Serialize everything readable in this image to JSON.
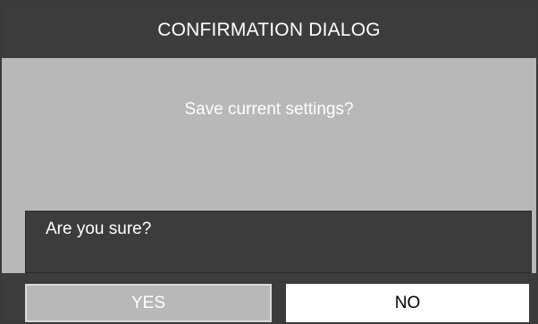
{
  "dialog": {
    "title": "CONFIRMATION DIALOG",
    "message": "Save current settings?",
    "prompt": "Are you sure?",
    "buttons": {
      "yes_label": "YES",
      "no_label": "NO"
    },
    "selected_button": "NO",
    "colors": {
      "title_bar": "#3c3c3c",
      "body": "#b8b8b8",
      "text": "#ffffff",
      "selected_button_bg": "#ffffff",
      "selected_button_text": "#000000"
    }
  }
}
